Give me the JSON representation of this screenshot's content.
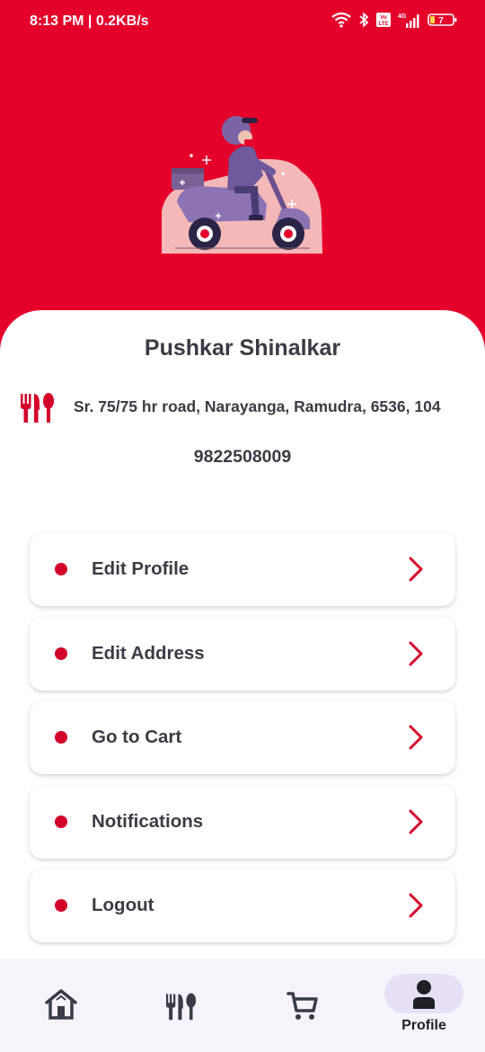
{
  "status_bar": {
    "time_speed": "8:13 PM | 0.2KB/s",
    "network": "4G",
    "volte": "Vo LTE",
    "battery": "7"
  },
  "profile": {
    "name": "Pushkar Shinalkar",
    "address": "Sr. 75/75 hr road, Narayanga, Ramudra, 6536, 104",
    "phone": "9822508009"
  },
  "menu": {
    "items": [
      {
        "label": "Edit Profile"
      },
      {
        "label": "Edit Address"
      },
      {
        "label": "Go to Cart"
      },
      {
        "label": "Notifications"
      },
      {
        "label": "Logout"
      }
    ]
  },
  "bottom_nav": {
    "items": [
      {
        "icon": "home-icon"
      },
      {
        "icon": "restaurant-icon"
      },
      {
        "icon": "cart-icon"
      },
      {
        "icon": "person-icon",
        "label": "Profile",
        "active": true
      }
    ]
  },
  "colors": {
    "brand": "#e4002b",
    "accent": "#d3002a",
    "text": "#3b3b45",
    "nav_background": "#f6f4fa",
    "active_pill": "#e7dff5"
  }
}
